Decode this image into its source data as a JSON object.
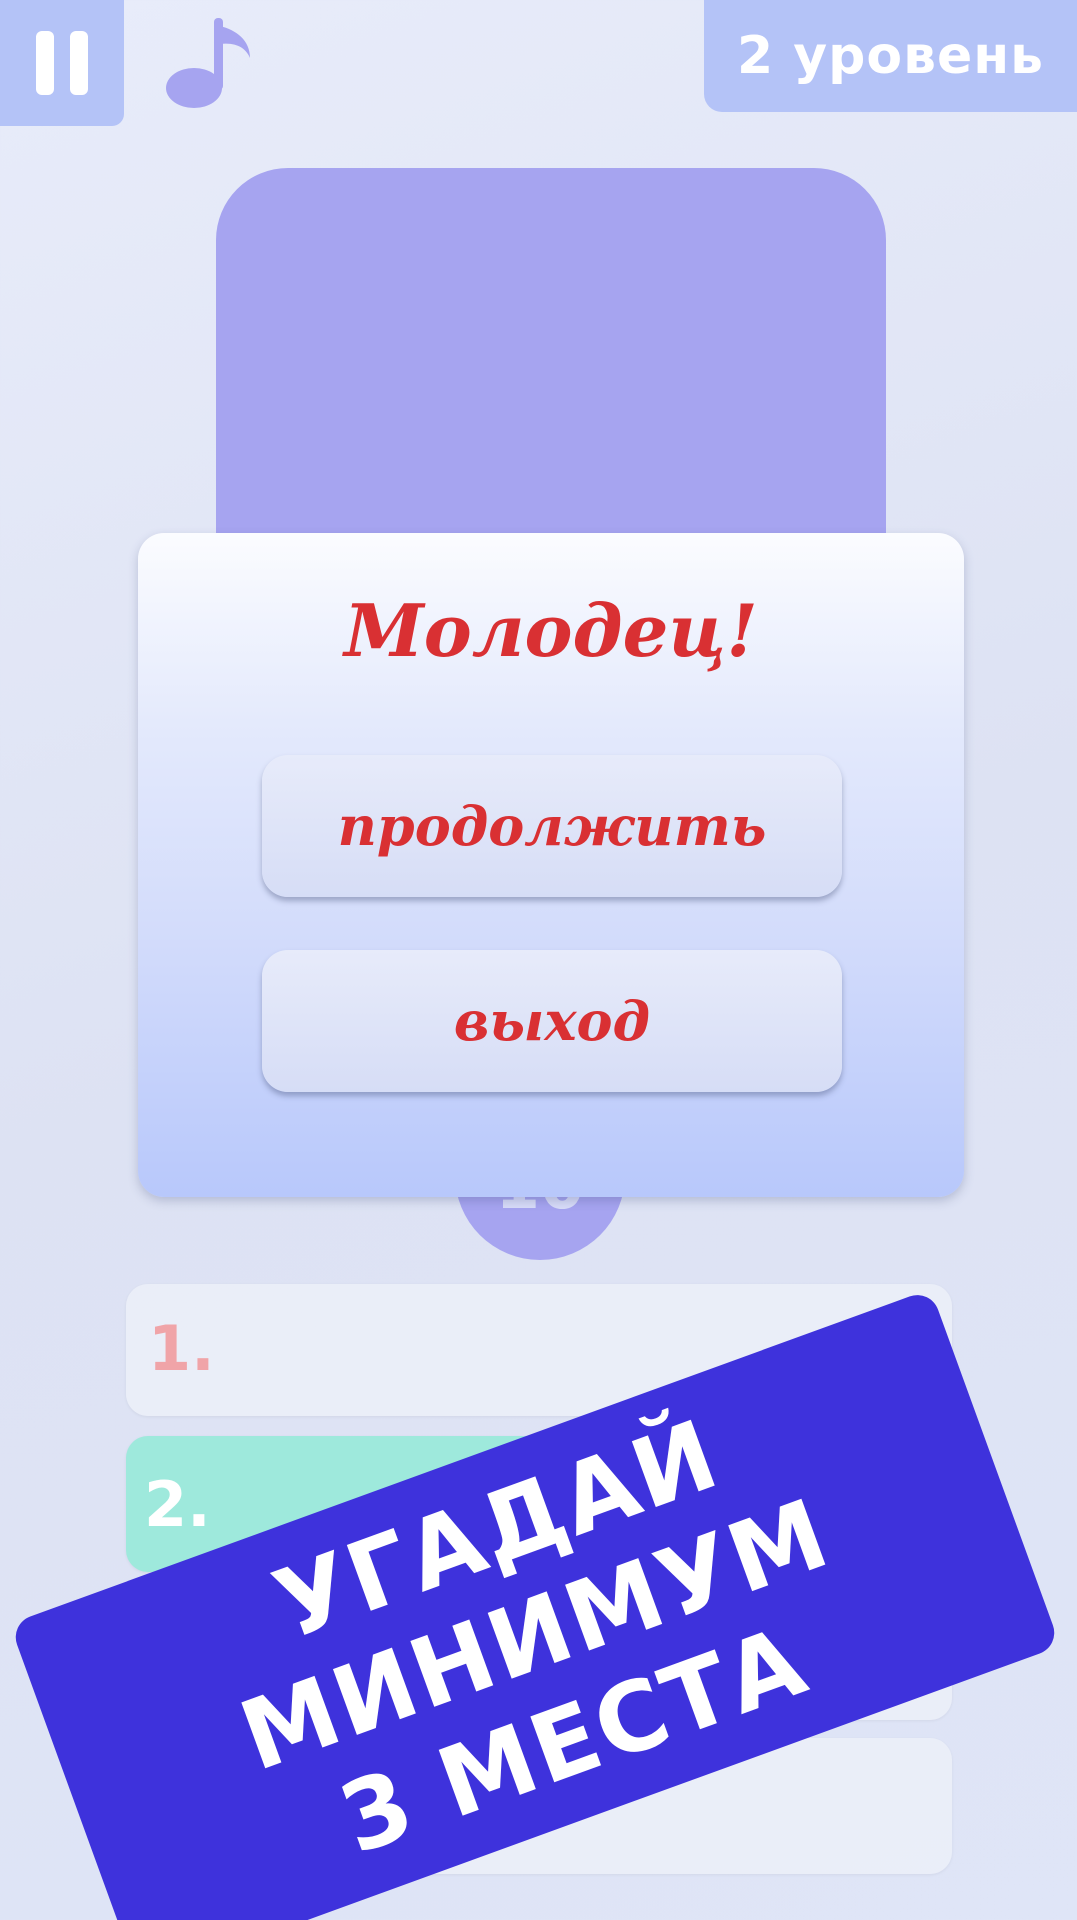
{
  "top_bar": {
    "level_label": "2 уровень",
    "pause_icon": "pause-icon",
    "music_icon": "music-note-icon"
  },
  "modal": {
    "title": "Молодец!",
    "continue_label": "продолжить",
    "exit_label": "выход"
  },
  "game": {
    "timer_value": "10",
    "slots": [
      {
        "number": "1."
      },
      {
        "number": "2."
      }
    ]
  },
  "banner": {
    "line1": "УГАДАЙ МИНИМУМ",
    "line2": "3 МЕСТА"
  },
  "colors": {
    "accent": "#a6a4f0",
    "title_red": "#d93033",
    "banner_blue": "#3e32dc",
    "slot_teal": "#9ee9dc"
  }
}
